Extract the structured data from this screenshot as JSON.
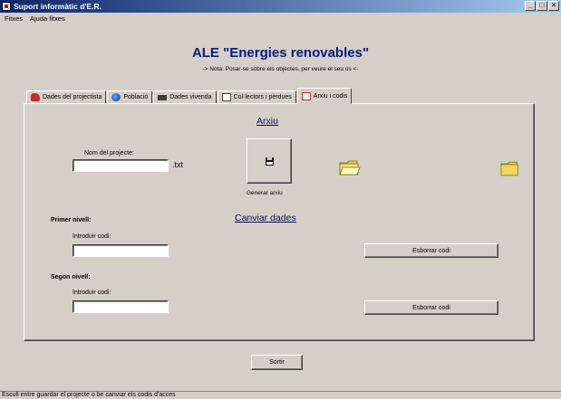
{
  "window": {
    "title": "Suport informàtic d'E.R."
  },
  "menu": [
    {
      "label": "Fitxes",
      "key": "F"
    },
    {
      "label": "Ajuda fitxes",
      "key": "A"
    }
  ],
  "header": {
    "title": "ALE \"Energies renovables\"",
    "note": "-> Nota: Posar-se sobre els objectes, per veure el seu ús <-"
  },
  "tabs": [
    {
      "label": "Dades del projectista",
      "icon": "car-icon"
    },
    {
      "label": "Població",
      "icon": "globe-icon"
    },
    {
      "label": "Dades vivenda",
      "icon": "house-icon"
    },
    {
      "label": "Col·lectors i pèrdues",
      "icon": "calculator-icon"
    },
    {
      "label": "Arxiu i codis",
      "icon": "file-icon",
      "active": true
    }
  ],
  "arxiu": {
    "heading": "Arxiu",
    "project_label": "Nom del projecte:",
    "project_value": "",
    "extension": ".txt",
    "generate_label": "Generar arxiu"
  },
  "codes": {
    "heading": "Canviar dades",
    "level1_label": "Primer nivell:",
    "level1_input_label": "Introduir codi:",
    "level1_value": "",
    "level1_clear": "Esborrar codi",
    "level2_label": "Segon nivell:",
    "level2_input_label": "Introduir codi:",
    "level2_value": "",
    "level2_clear": "Esborrar codi"
  },
  "exit_label": "Sortir",
  "status": "Escull entre guardar el projecte o be canviar els codis d'acces"
}
